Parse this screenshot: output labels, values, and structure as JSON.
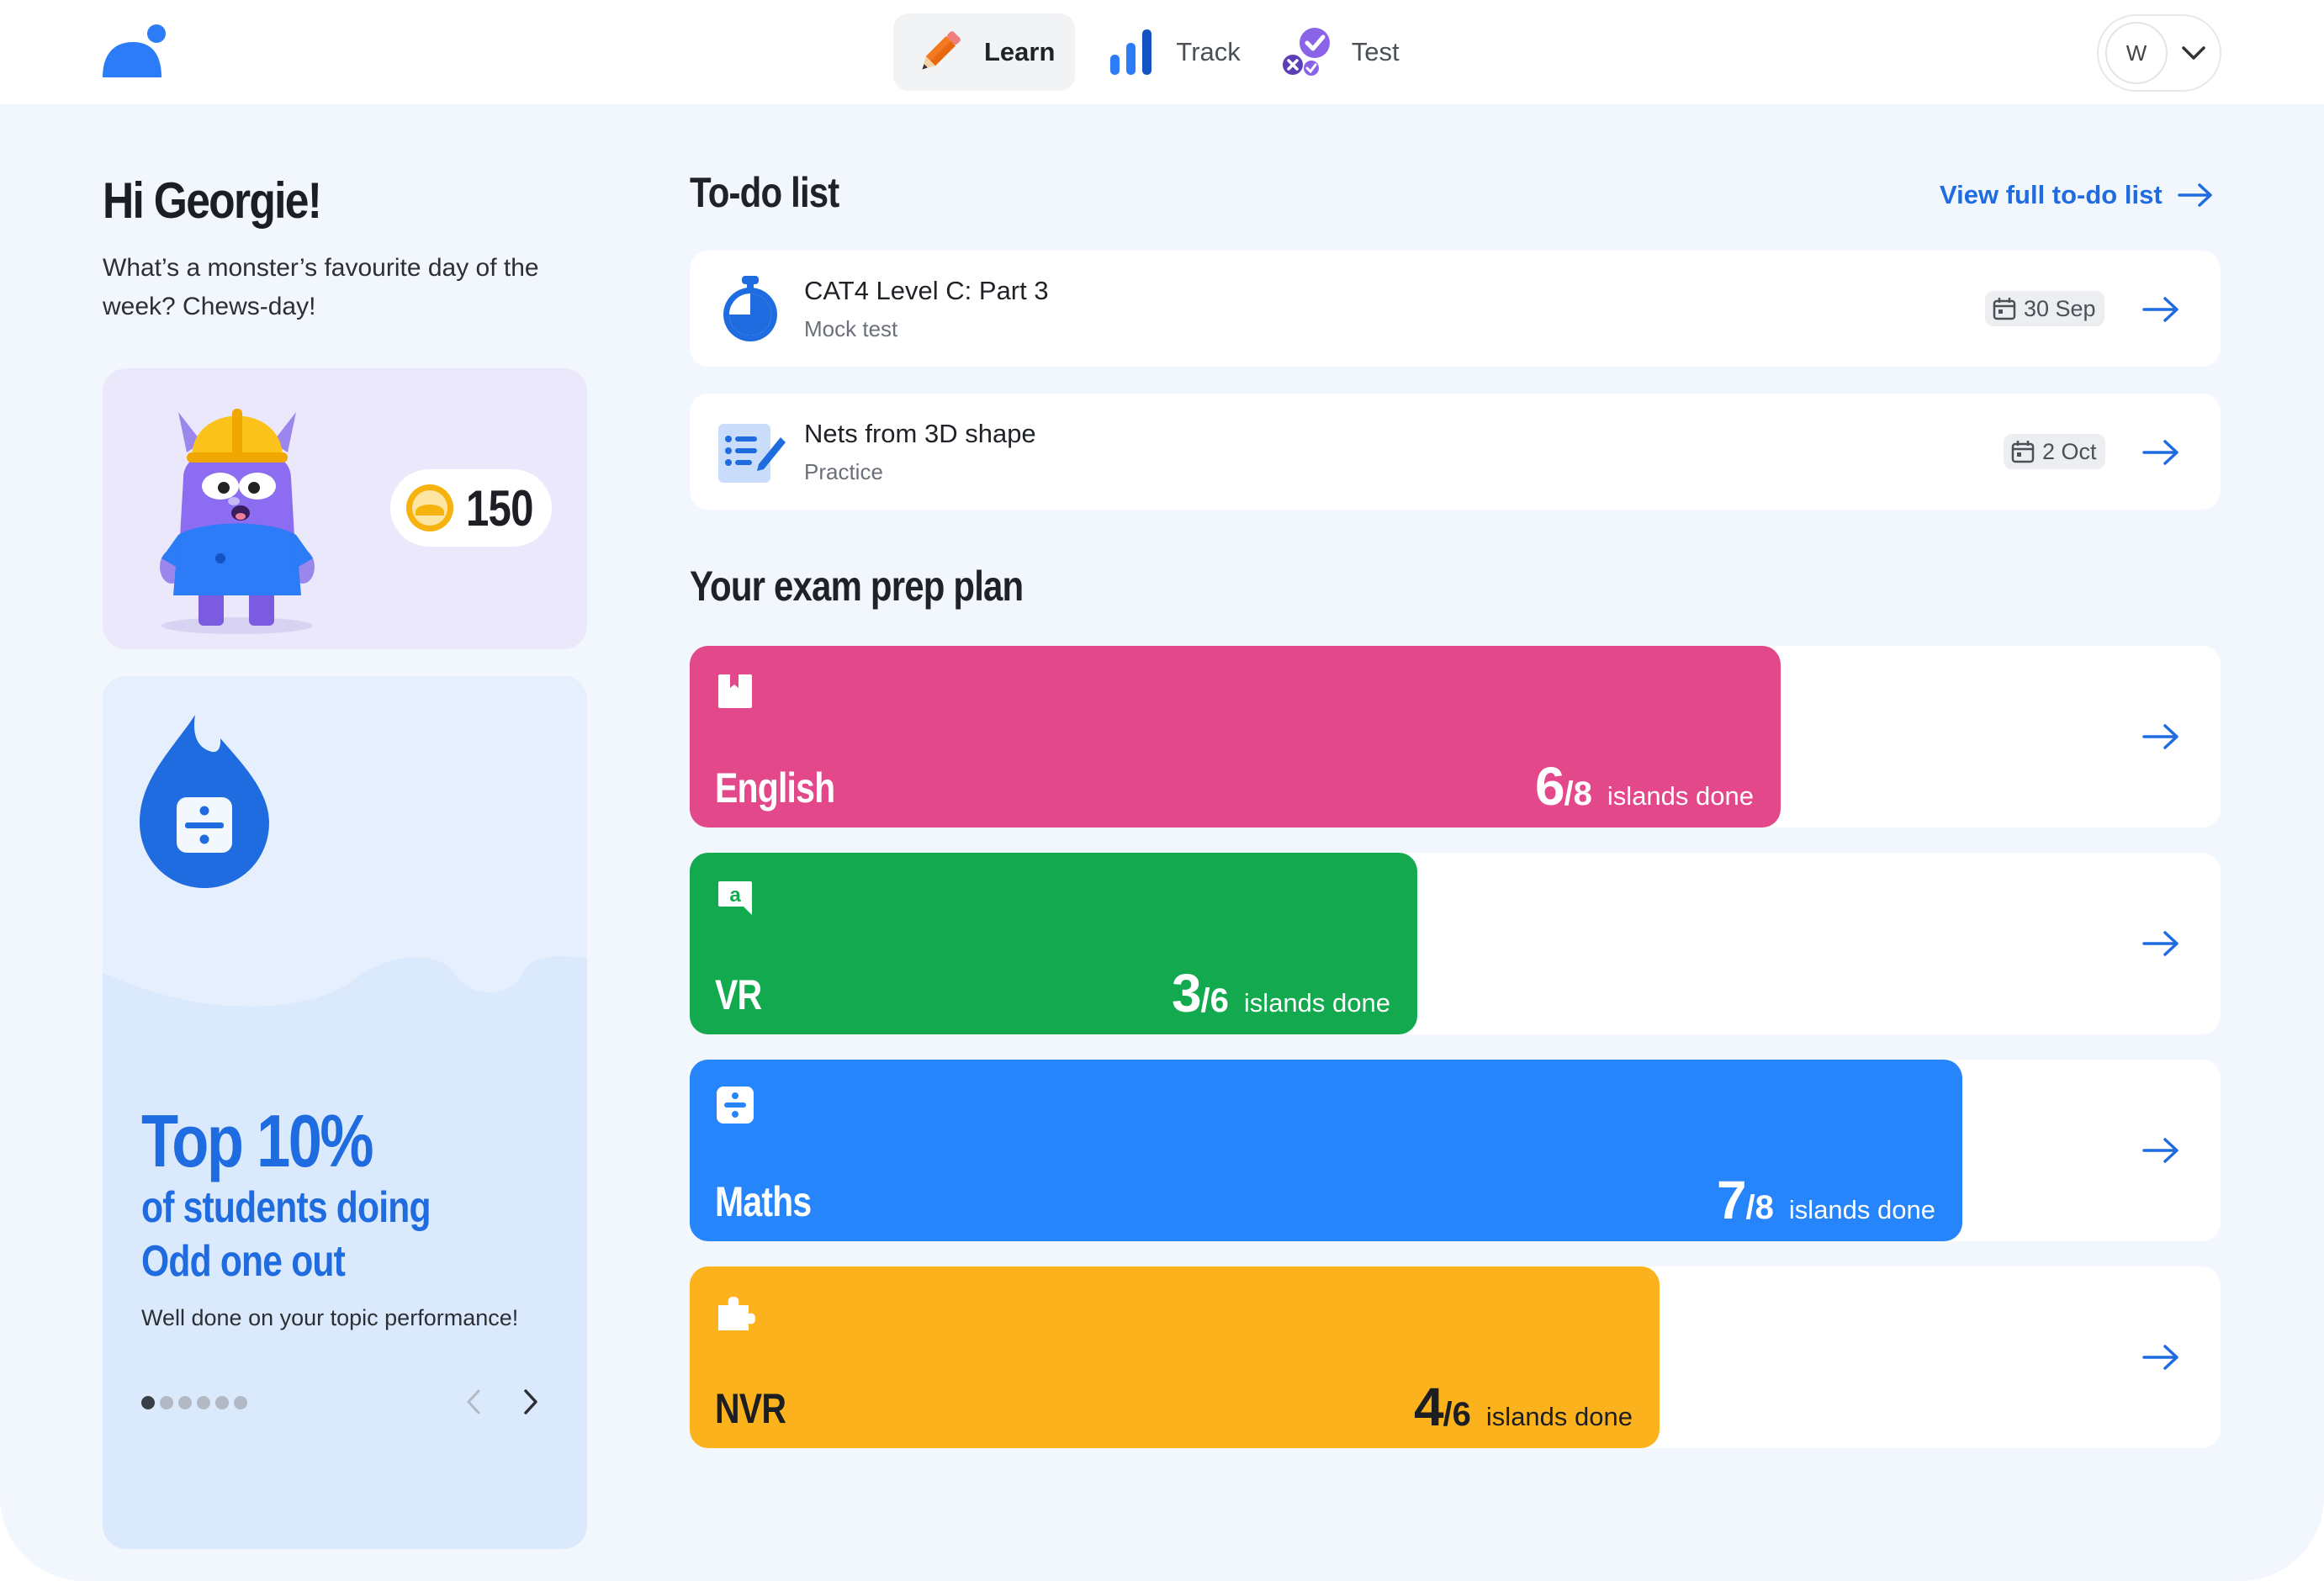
{
  "nav": {
    "items": [
      {
        "label": "Learn",
        "icon": "pencil-icon",
        "active": true
      },
      {
        "label": "Track",
        "icon": "bar-chart-icon",
        "active": false
      },
      {
        "label": "Test",
        "icon": "check-cross-icon",
        "active": false
      }
    ]
  },
  "user": {
    "initial": "W"
  },
  "greeting": {
    "title": "Hi Georgie!",
    "joke": "What’s a monster’s favourite day of the week? Chews-day!"
  },
  "coins": {
    "count": "150"
  },
  "stat": {
    "big": "Top 10%",
    "line1": "of students doing",
    "line2": "Odd one out",
    "note": "Well done on your topic performance!",
    "slides_total": 6,
    "slide_active": 1
  },
  "todo": {
    "title": "To-do list",
    "view_all": "View full to-do list",
    "items": [
      {
        "name": "CAT4 Level C: Part 3",
        "type": "Mock test",
        "date": "30 Sep"
      },
      {
        "name": "Nets from 3D shape",
        "type": "Practice",
        "date": "2 Oct"
      }
    ]
  },
  "plan": {
    "title": "Your exam prep plan",
    "subjects": [
      {
        "name": "English",
        "done": "6",
        "total": "8",
        "fraction": 0.75,
        "label": "islands done",
        "color": "#e3488b"
      },
      {
        "name": "VR",
        "done": "3",
        "total": "6",
        "fraction": 0.5,
        "label": "islands done",
        "color": "#12a94f"
      },
      {
        "name": "Maths",
        "done": "7",
        "total": "8",
        "fraction": 0.875,
        "label": "islands done",
        "color": "#2685fb"
      },
      {
        "name": "NVR",
        "done": "4",
        "total": "6",
        "fraction": 0.667,
        "label": "islands done",
        "color": "#fbb21c"
      }
    ]
  },
  "colors": {
    "accent": "#1f6be0",
    "background": "#f2f6fd"
  }
}
